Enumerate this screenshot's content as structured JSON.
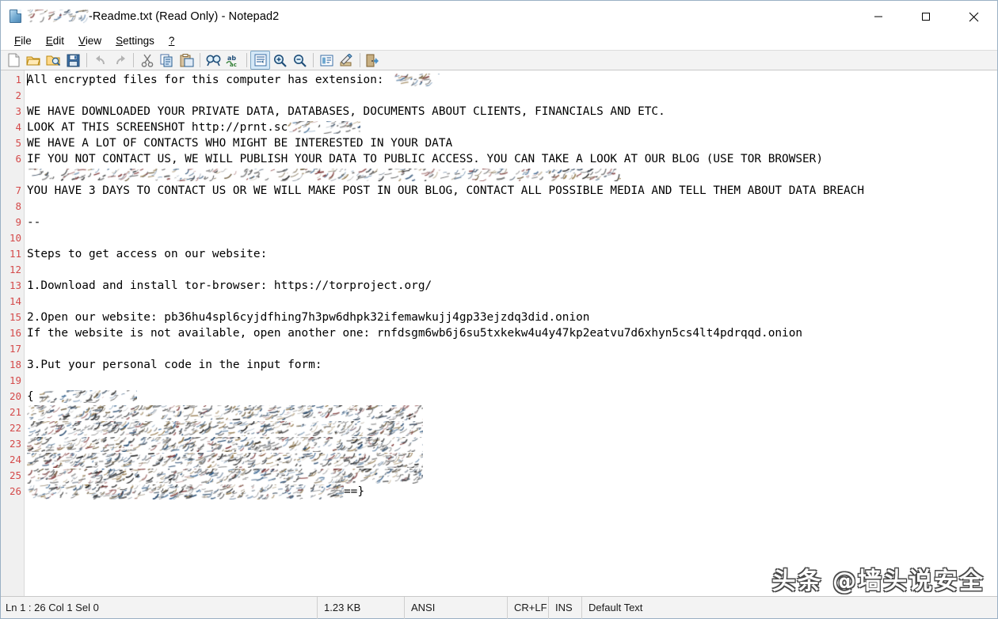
{
  "window": {
    "title_prefix": "",
    "title_suffix": "-Readme.txt (Read Only) - Notepad2",
    "icon": "document-icon",
    "minimize_label": "Minimize",
    "maximize_label": "Maximize",
    "close_label": "Close"
  },
  "menubar": {
    "items": [
      {
        "label": "File",
        "accel": "F"
      },
      {
        "label": "Edit",
        "accel": "E"
      },
      {
        "label": "View",
        "accel": "V"
      },
      {
        "label": "Settings",
        "accel": "S"
      },
      {
        "label": "?",
        "accel": "?"
      }
    ]
  },
  "toolbar": {
    "buttons": [
      {
        "name": "new-file-icon",
        "tooltip": "New"
      },
      {
        "name": "open-file-icon",
        "tooltip": "Open"
      },
      {
        "name": "browse-file-icon",
        "tooltip": "Browse"
      },
      {
        "name": "save-file-icon",
        "tooltip": "Save"
      },
      {
        "name": "separator",
        "tooltip": ""
      },
      {
        "name": "undo-icon",
        "tooltip": "Undo"
      },
      {
        "name": "redo-icon",
        "tooltip": "Redo"
      },
      {
        "name": "separator",
        "tooltip": ""
      },
      {
        "name": "cut-icon",
        "tooltip": "Cut"
      },
      {
        "name": "copy-icon",
        "tooltip": "Copy"
      },
      {
        "name": "paste-icon",
        "tooltip": "Paste"
      },
      {
        "name": "separator",
        "tooltip": ""
      },
      {
        "name": "find-icon",
        "tooltip": "Find"
      },
      {
        "name": "replace-icon",
        "tooltip": "Replace"
      },
      {
        "name": "separator",
        "tooltip": ""
      },
      {
        "name": "word-wrap-icon",
        "tooltip": "Word Wrap",
        "active": true
      },
      {
        "name": "zoom-in-icon",
        "tooltip": "Zoom In"
      },
      {
        "name": "zoom-out-icon",
        "tooltip": "Zoom Out"
      },
      {
        "name": "separator",
        "tooltip": ""
      },
      {
        "name": "scheme-icon",
        "tooltip": "Scheme"
      },
      {
        "name": "scheme-options-icon",
        "tooltip": "Scheme Options"
      },
      {
        "name": "separator",
        "tooltip": ""
      },
      {
        "name": "exit-icon",
        "tooltip": "Exit"
      }
    ]
  },
  "editor": {
    "line_numbers": [
      1,
      2,
      3,
      4,
      5,
      6,
      7,
      8,
      9,
      10,
      11,
      12,
      13,
      14,
      15,
      16,
      17,
      18,
      19,
      20,
      21,
      22,
      23,
      24,
      25,
      26
    ],
    "lines": [
      {
        "n": 1,
        "text": "All encrypted files for this computer has extension: ",
        "redacted_tail": true,
        "tail_w": 62,
        "caret": true
      },
      {
        "n": 2,
        "text": ""
      },
      {
        "n": 3,
        "text": "WE HAVE DOWNLOADED YOUR PRIVATE DATA, DATABASES, DOCUMENTS ABOUT CLIENTS, FINANCIALS AND ETC."
      },
      {
        "n": 4,
        "text": "LOOK AT THIS SCREENSHOT http://prnt.sc",
        "redacted_tail": true,
        "tail_w": 92
      },
      {
        "n": 5,
        "text": "WE HAVE A LOT OF CONTACTS WHO MIGHT BE INTERESTED IN YOUR DATA"
      },
      {
        "n": 6,
        "text": "IF YOU NOT CONTACT US, WE WILL PUBLISH YOUR DATA TO PUBLIC ACCESS. YOU CAN TAKE A LOOK AT OUR BLOG (USE TOR BROWSER)"
      },
      {
        "n": null,
        "text": "",
        "wrapped_redacted": true,
        "wrap_w": 750
      },
      {
        "n": 7,
        "text": "YOU HAVE 3 DAYS TO CONTACT US OR WE WILL MAKE POST IN OUR BLOG, CONTACT ALL POSSIBLE MEDIA AND TELL THEM ABOUT DATA BREACH"
      },
      {
        "n": 8,
        "text": ""
      },
      {
        "n": 9,
        "text": "--"
      },
      {
        "n": 10,
        "text": ""
      },
      {
        "n": 11,
        "text": "Steps to get access on our website:"
      },
      {
        "n": 12,
        "text": ""
      },
      {
        "n": 13,
        "text": "1.Download and install tor-browser: https://torproject.org/"
      },
      {
        "n": 14,
        "text": ""
      },
      {
        "n": 15,
        "text": "2.Open our website: pb36hu4spl6cyjdfhing7h3pw6dhpk32ifemawkujj4gp33ejzdq3did.onion"
      },
      {
        "n": 16,
        "text": "If the website is not available, open another one: rnfdsgm6wb6j6su5txkekw4u4y47kp2eatvu7d6xhyn5cs4lt4pdrqqd.onion"
      },
      {
        "n": 17,
        "text": ""
      },
      {
        "n": 18,
        "text": "3.Put your personal code in the input form:"
      },
      {
        "n": 19,
        "text": ""
      },
      {
        "n": 20,
        "text": "{",
        "redacted_tail": true,
        "tail_w": 130
      },
      {
        "n": 21,
        "text": "",
        "full_redacted": true,
        "block_w": 500
      },
      {
        "n": 22,
        "text": "",
        "full_redacted": true,
        "block_w": 500
      },
      {
        "n": 23,
        "text": "",
        "full_redacted": true,
        "block_w": 500
      },
      {
        "n": 24,
        "text": "",
        "full_redacted": true,
        "block_w": 500
      },
      {
        "n": 25,
        "text": "",
        "full_redacted": true,
        "block_w": 500
      },
      {
        "n": 26,
        "text": "",
        "full_redacted": true,
        "block_w": 400,
        "suffix": "==}"
      }
    ]
  },
  "statusbar": {
    "position": "Ln 1 : 26   Col 1   Sel 0",
    "file_size": "1.23 KB",
    "encoding": "ANSI",
    "line_endings": "CR+LF",
    "insert_mode": "INS",
    "scheme": "Default Text"
  },
  "watermark": {
    "text": "头条 @墙头说安全"
  },
  "colors": {
    "line_number": "#d44a4a",
    "gutter_bg": "#f0f0f0",
    "toolbar_bg": "#f3f3f3",
    "editor_bg": "#ffffff",
    "text": "#000000",
    "active_toolbtn": "#d5e8f7"
  }
}
